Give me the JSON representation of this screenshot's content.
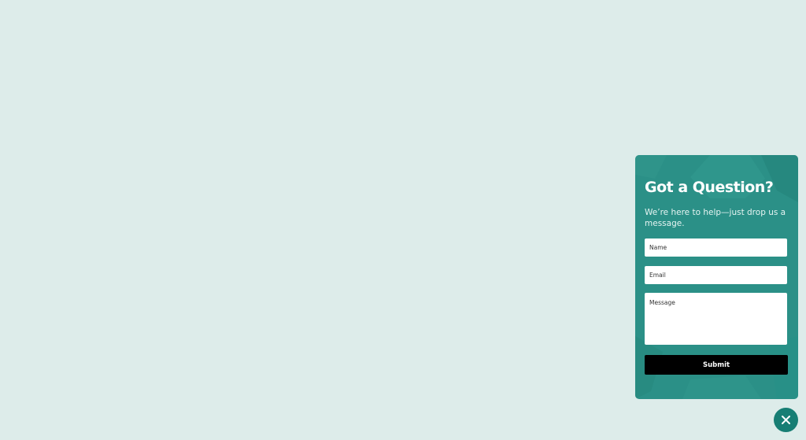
{
  "contact_form": {
    "title": "Got a Question?",
    "subtitle": "We’re here to help—just drop us a message.",
    "name_placeholder": "Name",
    "email_placeholder": "Email",
    "message_placeholder": "Message",
    "submit_label": "Submit"
  },
  "launcher": {
    "icon": "close-icon"
  },
  "colors": {
    "page_background": "#ddecea",
    "panel": "#2b9087",
    "submit_button": "#000000",
    "launcher": "#177e74"
  }
}
